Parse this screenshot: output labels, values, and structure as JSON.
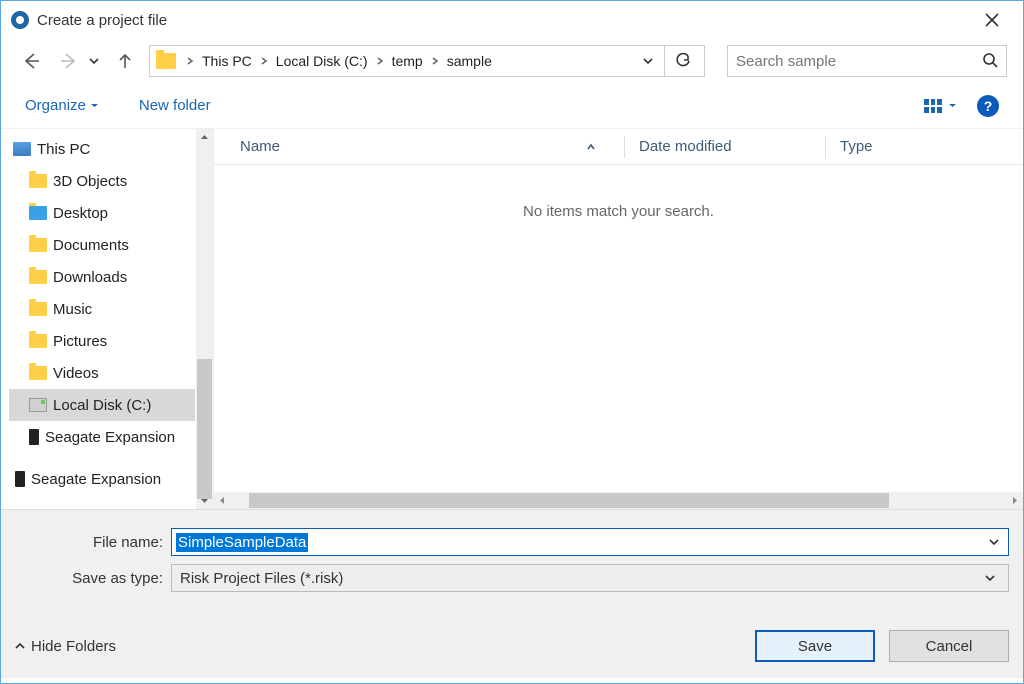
{
  "window": {
    "title": "Create a project file"
  },
  "nav": {
    "breadcrumb": [
      "This PC",
      "Local Disk (C:)",
      "temp",
      "sample"
    ],
    "search_placeholder": "Search sample"
  },
  "toolbar": {
    "organize": "Organize",
    "new_folder": "New folder"
  },
  "tree": {
    "root": "This PC",
    "items": [
      "3D Objects",
      "Desktop",
      "Documents",
      "Downloads",
      "Music",
      "Pictures",
      "Videos",
      "Local Disk (C:)",
      "Seagate Expansion"
    ],
    "cutoff": "Seagate Expansion"
  },
  "columns": {
    "name": "Name",
    "date": "Date modified",
    "type": "Type"
  },
  "empty_message": "No items match your search.",
  "form": {
    "filename_label": "File name:",
    "filename_value": "SimpleSampleData",
    "type_label": "Save as type:",
    "type_value": "Risk Project Files  (*.risk)"
  },
  "footer": {
    "hide_folders": "Hide Folders",
    "save": "Save",
    "cancel": "Cancel"
  }
}
